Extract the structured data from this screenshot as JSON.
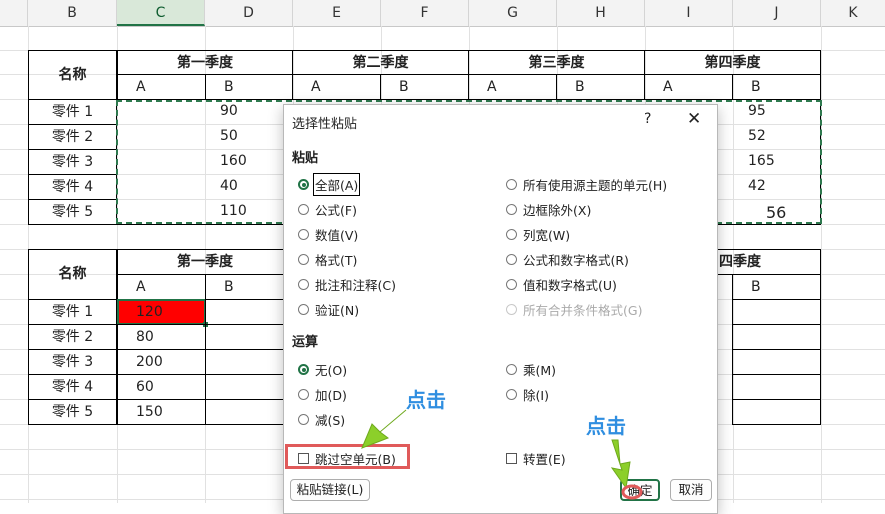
{
  "columns": [
    "B",
    "C",
    "D",
    "E",
    "F",
    "G",
    "H",
    "I",
    "J",
    "K"
  ],
  "table1": {
    "name_header": "名称",
    "quarters": [
      "第一季度",
      "第二季度",
      "第三季度",
      "第四季度"
    ],
    "sub_a": "A",
    "sub_b": "B",
    "rows": [
      {
        "name": "零件 1",
        "q1b": "90",
        "q4b": "95"
      },
      {
        "name": "零件 2",
        "q1b": "50",
        "q4b": "52"
      },
      {
        "name": "零件 3",
        "q1b": "160",
        "q4b": "165"
      },
      {
        "name": "零件 4",
        "q1b": "40",
        "q4b": "42"
      },
      {
        "name": "零件 5",
        "q1b": "110",
        "q4b": "56"
      }
    ]
  },
  "table2": {
    "name_header": "名称",
    "q1": "第一季度",
    "q4_partial": "四季度",
    "sub_a": "A",
    "sub_b": "B",
    "rows": [
      {
        "name": "零件 1",
        "q1a": "120"
      },
      {
        "name": "零件 2",
        "q1a": "80"
      },
      {
        "name": "零件 3",
        "q1a": "200"
      },
      {
        "name": "零件 4",
        "q1a": "60"
      },
      {
        "name": "零件 5",
        "q1a": "150"
      }
    ],
    "highlight_color": "#ff0000"
  },
  "dialog": {
    "title": "选择性粘贴",
    "help": "?",
    "close": "✕",
    "paste_section": "粘贴",
    "paste_options_left": [
      "全部(A)",
      "公式(F)",
      "数值(V)",
      "格式(T)",
      "批注和注释(C)",
      "验证(N)"
    ],
    "paste_options_right": [
      "所有使用源主题的单元(H)",
      "边框除外(X)",
      "列宽(W)",
      "公式和数字格式(R)",
      "值和数字格式(U)",
      "所有合并条件格式(G)"
    ],
    "operation_section": "运算",
    "operation_left": [
      "无(O)",
      "加(D)",
      "减(S)"
    ],
    "operation_right": [
      "乘(M)",
      "除(I)"
    ],
    "skip_blanks": "跳过空单元(B)",
    "transpose": "转置(E)",
    "paste_link": "粘贴链接(L)",
    "ok": "确定",
    "cancel": "取消"
  },
  "annotations": {
    "click1": "点击",
    "click2": "点击"
  },
  "accent_color": "#217346"
}
